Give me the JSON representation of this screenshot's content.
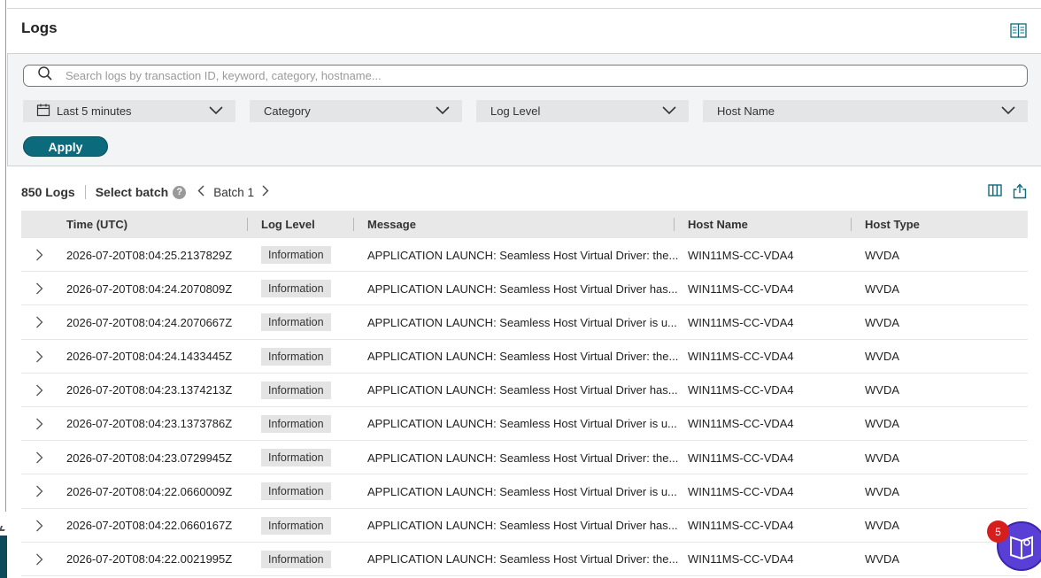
{
  "header": {
    "title": "Logs"
  },
  "search": {
    "placeholder": "Search logs by transaction ID, keyword, category, hostname..."
  },
  "filters": {
    "time": "Last 5 minutes",
    "category": "Category",
    "log_level": "Log Level",
    "host_name": "Host Name",
    "apply_label": "Apply"
  },
  "toolbar": {
    "log_count": "850 Logs",
    "select_batch": "Select batch",
    "help": "?",
    "batch": "Batch 1"
  },
  "table": {
    "columns": [
      "Time (UTC)",
      "Log Level",
      "Message",
      "Host Name",
      "Host Type"
    ],
    "rows": [
      {
        "time": "2026-07-20T08:04:25.2137829Z",
        "level": "Information",
        "message": "APPLICATION LAUNCH: Seamless Host Virtual Driver: the...",
        "host": "WIN11MS-CC-VDA4",
        "type": "WVDA"
      },
      {
        "time": "2026-07-20T08:04:24.2070809Z",
        "level": "Information",
        "message": "APPLICATION LAUNCH: Seamless Host Virtual Driver has...",
        "host": "WIN11MS-CC-VDA4",
        "type": "WVDA"
      },
      {
        "time": "2026-07-20T08:04:24.2070667Z",
        "level": "Information",
        "message": "APPLICATION LAUNCH: Seamless Host Virtual Driver is u...",
        "host": "WIN11MS-CC-VDA4",
        "type": "WVDA"
      },
      {
        "time": "2026-07-20T08:04:24.1433445Z",
        "level": "Information",
        "message": "APPLICATION LAUNCH: Seamless Host Virtual Driver: the...",
        "host": "WIN11MS-CC-VDA4",
        "type": "WVDA"
      },
      {
        "time": "2026-07-20T08:04:23.1374213Z",
        "level": "Information",
        "message": "APPLICATION LAUNCH: Seamless Host Virtual Driver has...",
        "host": "WIN11MS-CC-VDA4",
        "type": "WVDA"
      },
      {
        "time": "2026-07-20T08:04:23.1373786Z",
        "level": "Information",
        "message": "APPLICATION LAUNCH: Seamless Host Virtual Driver is u...",
        "host": "WIN11MS-CC-VDA4",
        "type": "WVDA"
      },
      {
        "time": "2026-07-20T08:04:23.0729945Z",
        "level": "Information",
        "message": "APPLICATION LAUNCH: Seamless Host Virtual Driver: the...",
        "host": "WIN11MS-CC-VDA4",
        "type": "WVDA"
      },
      {
        "time": "2026-07-20T08:04:22.0660009Z",
        "level": "Information",
        "message": "APPLICATION LAUNCH: Seamless Host Virtual Driver is u...",
        "host": "WIN11MS-CC-VDA4",
        "type": "WVDA"
      },
      {
        "time": "2026-07-20T08:04:22.0660167Z",
        "level": "Information",
        "message": "APPLICATION LAUNCH: Seamless Host Virtual Driver has...",
        "host": "WIN11MS-CC-VDA4",
        "type": "WVDA"
      },
      {
        "time": "2026-07-20T08:04:22.0021995Z",
        "level": "Information",
        "message": "APPLICATION LAUNCH: Seamless Host Virtual Driver: the...",
        "host": "WIN11MS-CC-VDA4",
        "type": "WVDA"
      }
    ]
  },
  "chat": {
    "badge_count": "5"
  },
  "colors": {
    "accent": "#0b6b7d",
    "chat": "#5a3fd6",
    "badge": "#d71e1e"
  }
}
